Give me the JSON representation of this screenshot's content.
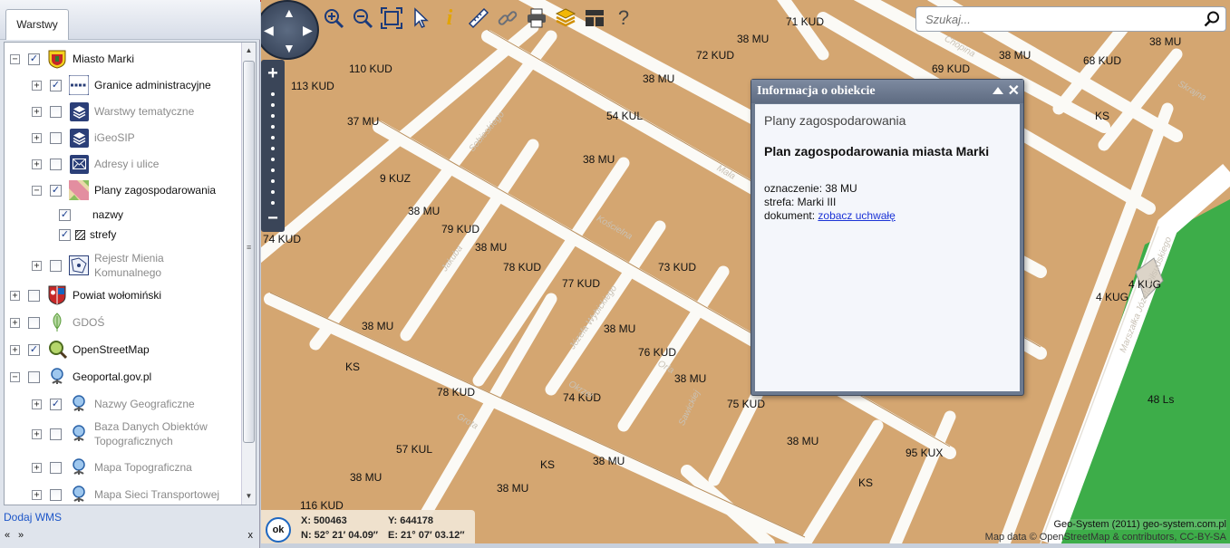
{
  "left_panel": {
    "tab_label": "Warstwy",
    "layers": [
      {
        "label": "Miasto Marki",
        "expander": "−",
        "checked": true,
        "icon": "city-crest-icon"
      },
      {
        "label": "Granice administracyjne",
        "expander": "+",
        "checked": true,
        "icon": "boundary-line-icon"
      },
      {
        "label": "Warstwy tematyczne",
        "expander": "+",
        "checked": false,
        "icon": "layers-icon"
      },
      {
        "label": "iGeoSIP",
        "expander": "+",
        "checked": false,
        "icon": "layers-icon"
      },
      {
        "label": "Adresy i ulice",
        "expander": "+",
        "checked": false,
        "icon": "envelope-icon"
      },
      {
        "label": "Plany zagospodarowania",
        "expander": "−",
        "checked": true,
        "icon": "zoning-plan-icon"
      },
      {
        "label": "nazwy",
        "checked": true
      },
      {
        "label": "strefy",
        "checked": true,
        "icon": "hatch-pattern-icon"
      },
      {
        "label": "Rejestr Mienia Komunalnego",
        "expander": "+",
        "checked": false,
        "icon": "property-register-icon"
      },
      {
        "label": "Powiat wołomiński",
        "expander": "+",
        "checked": false,
        "icon": "county-crest-icon"
      },
      {
        "label": "GDOŚ",
        "expander": "+",
        "checked": false,
        "icon": "leaf-icon"
      },
      {
        "label": "OpenStreetMap",
        "expander": "+",
        "checked": true,
        "icon": "magnifier-map-icon"
      },
      {
        "label": "Geoportal.gov.pl",
        "expander": "−",
        "checked": false,
        "icon": "geoportal-icon"
      },
      {
        "label": "Nazwy Geograficzne",
        "expander": "+",
        "checked": true,
        "icon": "geoportal-icon"
      },
      {
        "label": "Baza Danych Obiektów Topograficznych",
        "expander": "+",
        "checked": false,
        "icon": "geoportal-icon"
      },
      {
        "label": "Mapa Topograficzna",
        "expander": "+",
        "checked": false,
        "icon": "geoportal-icon"
      },
      {
        "label": "Mapa Sieci Transportowej",
        "expander": "+",
        "checked": false,
        "icon": "geoportal-icon"
      }
    ],
    "add_wms": "Dodaj WMS",
    "nav_prev": "«",
    "nav_next": "»",
    "nav_close": "x"
  },
  "toolbar": {
    "tools": [
      "zoom-in-icon",
      "zoom-out-icon",
      "zoom-extent-icon",
      "pointer-icon",
      "info-icon",
      "ruler-icon",
      "link-icon",
      "print-icon",
      "layers-stack-icon",
      "layout-icon",
      "help-icon"
    ],
    "help_glyph": "?",
    "info_glyph": "i"
  },
  "search": {
    "placeholder": "Szukaj..."
  },
  "nav_control": {
    "up": "▲",
    "down": "▼",
    "left": "◀",
    "right": "▶",
    "zoom_in": "+",
    "zoom_out": "−"
  },
  "info_window": {
    "title": "Informacja o obiekcie",
    "close": "✕",
    "subtitle": "Plany zagospodarowania",
    "plan_name": "Plan zagospodarowania miasta Marki",
    "designation": "oznaczenie: 38 MU",
    "zone": "strefa: Marki III",
    "document_label": "dokument:",
    "document_link": "zobacz uchwałę"
  },
  "coordinates": {
    "ok": "ok",
    "x": "X: 500463",
    "y": "Y: 644178",
    "n": "N: 52° 21′ 04.09″",
    "e": "E: 21° 07′ 03.12″"
  },
  "attribution": {
    "line1": "Geo-System (2011) geo-system.com.pl",
    "line2": "Map data © OpenStreetMap & contributors, CC-BY-SA"
  },
  "map_labels": [
    "71 KUD",
    "38 MU",
    "38 MU",
    "110 KUD",
    "72 KUD",
    "69 KUD",
    "38 MU",
    "68 KUD",
    "113 KUD",
    "38 MU",
    "37 MU",
    "54 KUL",
    "KS",
    "38 MU",
    "9 KUZ",
    "38 MU",
    "79 KUD",
    "38 MU",
    "74 KUD",
    "78 KUD",
    "73 KUD",
    "77 KUD",
    "4 KUG",
    "4 KUG",
    "38 MU",
    "38 MU",
    "76 KUD",
    "KS",
    "38 MU",
    "78 KUD",
    "74 KUD",
    "75 KUD",
    "48 Ls",
    "38 MU",
    "57 KUL",
    "38 MU",
    "95 KUX",
    "KS",
    "38 MU",
    "KS",
    "38 MU",
    "116 KUD"
  ],
  "street_labels": [
    "Sobieskiego",
    "Mała",
    "Kościelna",
    "Jakuba",
    "Józefa Wybickiego",
    "Orla",
    "Sawickiej",
    "Marszałka Józefa Piłsudskiego",
    "Okrzei",
    "Skrajna",
    "Chopina",
    "Grota"
  ]
}
